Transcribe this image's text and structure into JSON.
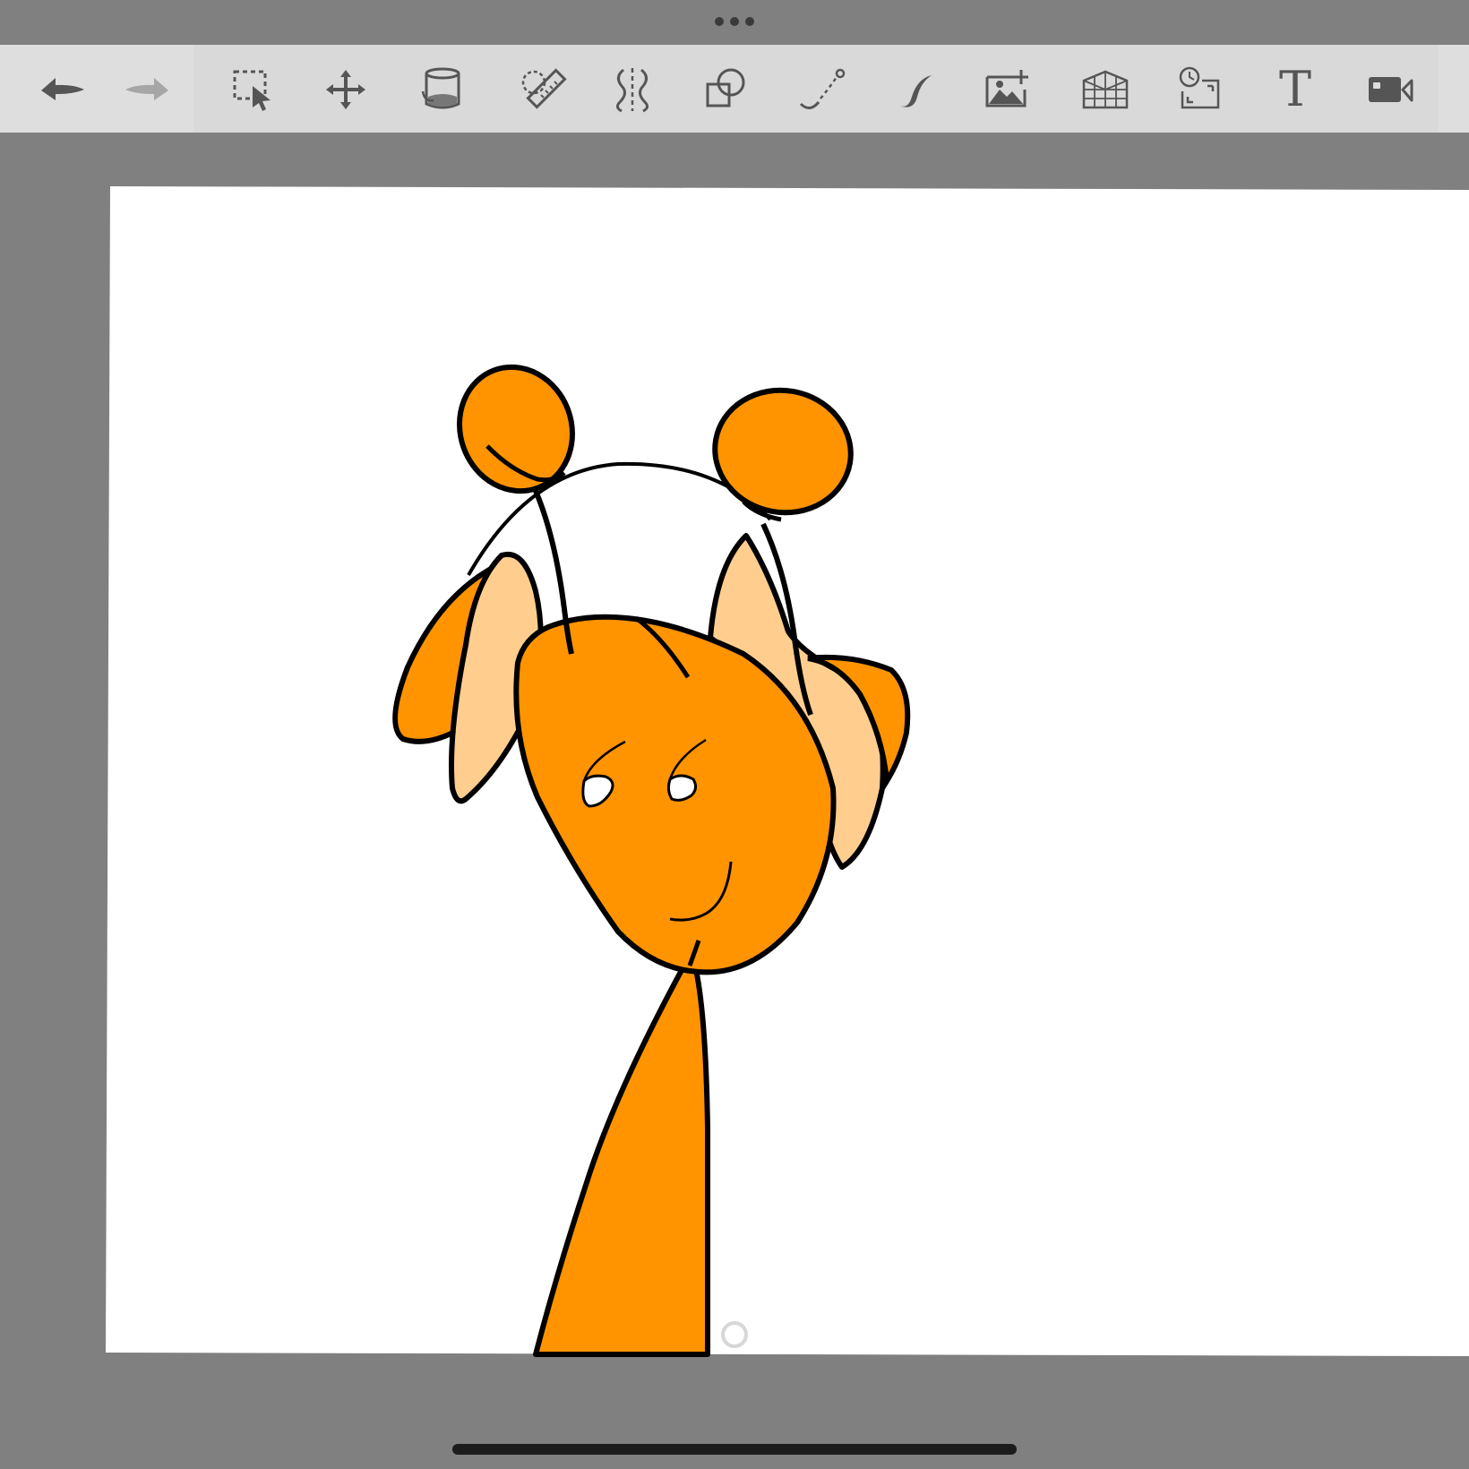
{
  "toolbar": {
    "tools": [
      {
        "id": "undo",
        "icon": "undo-icon"
      },
      {
        "id": "redo",
        "icon": "redo-icon"
      },
      {
        "id": "selection",
        "icon": "selection-icon"
      },
      {
        "id": "transform",
        "icon": "move-icon"
      },
      {
        "id": "fill",
        "icon": "paint-bucket-icon"
      },
      {
        "id": "ruler",
        "icon": "ruler-icon"
      },
      {
        "id": "symmetry",
        "icon": "symmetry-icon"
      },
      {
        "id": "shapes",
        "icon": "shapes-icon"
      },
      {
        "id": "curve",
        "icon": "curve-icon"
      },
      {
        "id": "stroke",
        "icon": "stroke-icon"
      },
      {
        "id": "add-image",
        "icon": "add-image-icon"
      },
      {
        "id": "perspective",
        "icon": "perspective-grid-icon"
      },
      {
        "id": "time-lapse",
        "icon": "time-lapse-icon"
      },
      {
        "id": "text",
        "icon": "text-icon",
        "glyph": "T"
      },
      {
        "id": "record",
        "icon": "video-camera-icon"
      }
    ]
  },
  "colors": {
    "background": "#808080",
    "toolbar": "#dedede",
    "icon": "#555555",
    "icon_disabled": "#a6a6a6",
    "canvas": "#ffffff",
    "orange_fill": "#ff9400",
    "light_fill": "#ffce8f",
    "outline": "#000000"
  }
}
